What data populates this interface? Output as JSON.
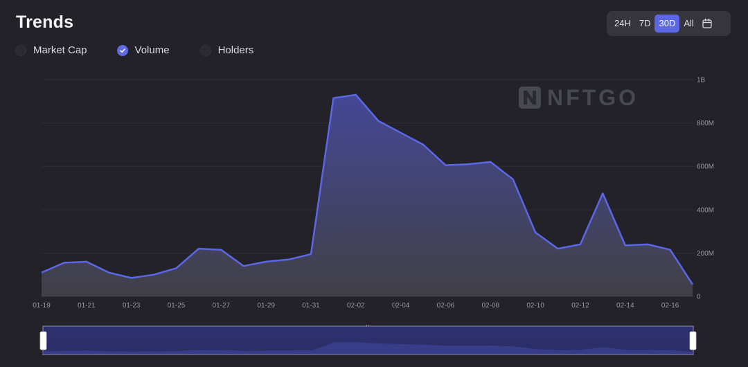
{
  "title": "Trends",
  "metrics": [
    {
      "label": "Market Cap",
      "checked": false
    },
    {
      "label": "Volume",
      "checked": true
    },
    {
      "label": "Holders",
      "checked": false
    }
  ],
  "range_buttons": [
    {
      "label": "24H",
      "active": false
    },
    {
      "label": "7D",
      "active": false
    },
    {
      "label": "30D",
      "active": true
    },
    {
      "label": "All",
      "active": false
    }
  ],
  "calendar_icon": "calendar-icon",
  "watermark": "NFTGO",
  "colors": {
    "line": "#5b67e6",
    "accent": "#5c67e6",
    "background": "#232228"
  },
  "chart_data": {
    "type": "area",
    "x_tick_labels": [
      "01-19",
      "01-21",
      "01-23",
      "01-25",
      "01-27",
      "01-29",
      "01-31",
      "02-02",
      "02-04",
      "02-06",
      "02-08",
      "02-10",
      "02-12",
      "02-14",
      "02-16"
    ],
    "y_tick_labels": [
      "0",
      "200M",
      "400M",
      "600M",
      "800M",
      "1B"
    ],
    "ylim": [
      0,
      1000000000
    ],
    "grid": true,
    "series": [
      {
        "x": [
          "01-19",
          "01-20",
          "01-21",
          "01-22",
          "01-23",
          "01-24",
          "01-25",
          "01-26",
          "01-27",
          "01-28",
          "01-29",
          "01-30",
          "01-31",
          "02-01",
          "02-02",
          "02-03",
          "02-04",
          "02-05",
          "02-06",
          "02-07",
          "02-08",
          "02-09",
          "02-10",
          "02-11",
          "02-12",
          "02-13",
          "02-14",
          "02-15",
          "02-16",
          "02-17"
        ],
        "values": [
          110000000,
          155000000,
          160000000,
          110000000,
          85000000,
          100000000,
          130000000,
          220000000,
          215000000,
          140000000,
          160000000,
          170000000,
          195000000,
          915000000,
          930000000,
          810000000,
          755000000,
          700000000,
          605000000,
          610000000,
          620000000,
          540000000,
          295000000,
          220000000,
          240000000,
          475000000,
          235000000,
          240000000,
          215000000,
          55000000
        ]
      }
    ]
  }
}
